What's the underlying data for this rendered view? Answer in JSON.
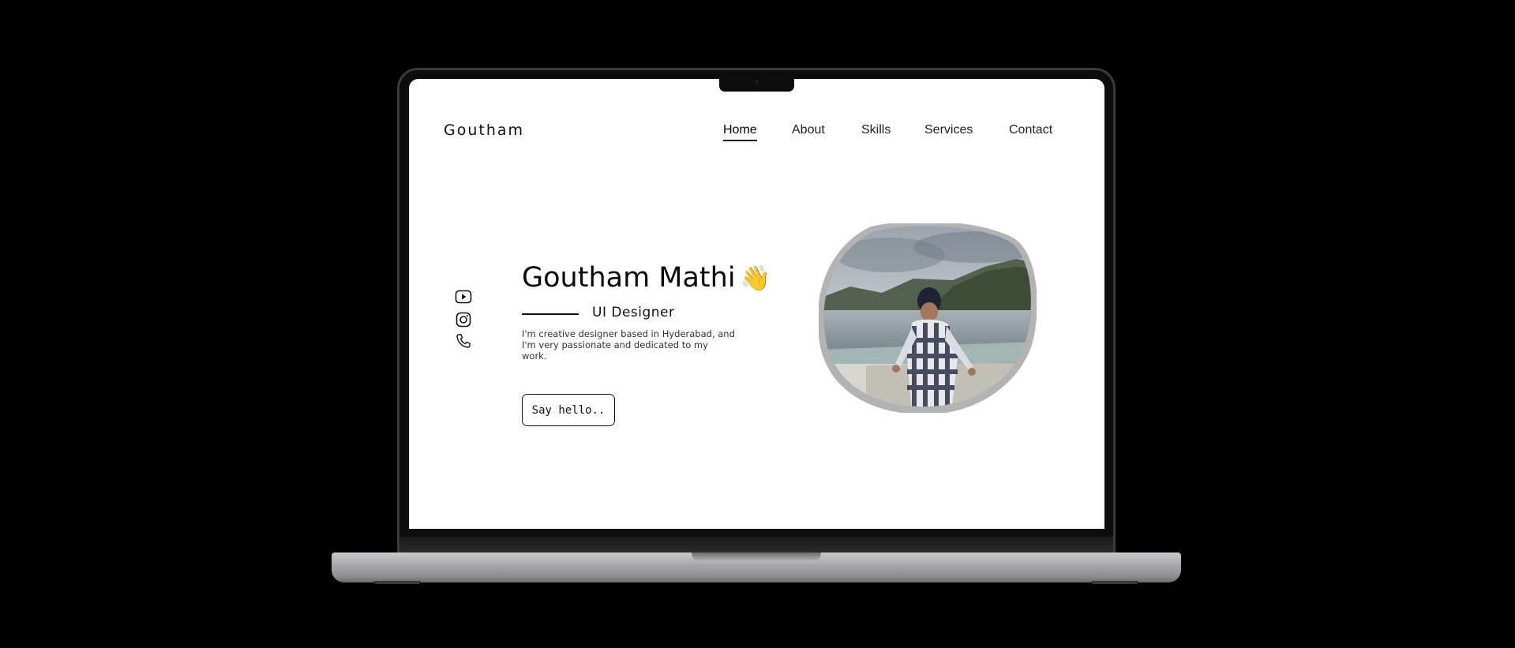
{
  "site": {
    "logo": "Goutham"
  },
  "nav": {
    "items": [
      {
        "label": "Home",
        "active": true
      },
      {
        "label": "About",
        "active": false
      },
      {
        "label": "Skills",
        "active": false
      },
      {
        "label": "Services",
        "active": false
      },
      {
        "label": "Contact",
        "active": false
      }
    ]
  },
  "social": {
    "icons": [
      "youtube-icon",
      "instagram-icon",
      "phone-icon"
    ]
  },
  "hero": {
    "name": "Goutham Mathi",
    "emoji": "👋",
    "role": "UI Designer",
    "description": "I'm creative designer based in Hyderabad, and I'm very passionate and dedicated to my work.",
    "cta_label": "Say hello.."
  },
  "colors": {
    "page_background": "#000000",
    "screen_background": "#ffffff",
    "text": "#111111",
    "photo_frame": "#b3b3b3"
  }
}
